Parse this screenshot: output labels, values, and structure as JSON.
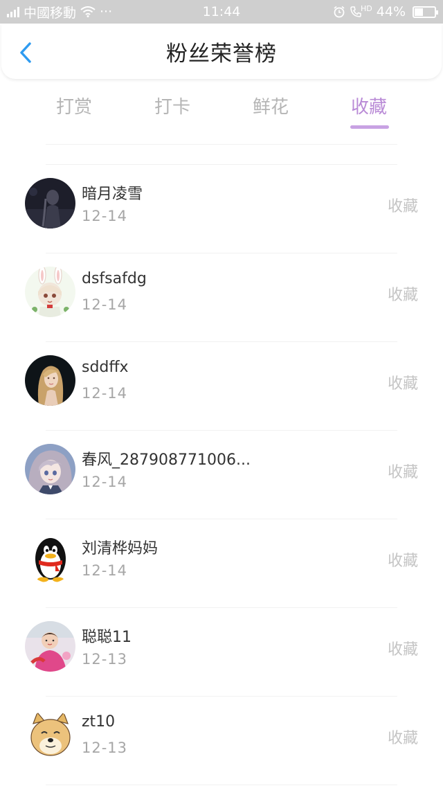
{
  "status_bar": {
    "carrier": "中國移動",
    "dots": "···",
    "time": "11:44",
    "hd": "HD",
    "battery": "44%"
  },
  "header": {
    "title": "粉丝荣誉榜",
    "back_icon": "chevron-left-icon",
    "accent": "#2f9bf0"
  },
  "tabs": [
    {
      "label": "打赏",
      "active": false
    },
    {
      "label": "打卡",
      "active": false
    },
    {
      "label": "鲜花",
      "active": false
    },
    {
      "label": "收藏",
      "active": true
    }
  ],
  "accent_color": "#b98ad6",
  "items": [
    {
      "name": "暗月凌雪",
      "date": "12-14",
      "action": "收藏",
      "avatar": "dark-figure-avatar"
    },
    {
      "name": "dsfsafdg",
      "date": "12-14",
      "action": "收藏",
      "avatar": "bunny-girl-avatar"
    },
    {
      "name": "sddffx",
      "date": "12-14",
      "action": "收藏",
      "avatar": "blonde-girl-avatar"
    },
    {
      "name": "春风_287908771006...",
      "date": "12-14",
      "action": "收藏",
      "avatar": "anime-girl-avatar"
    },
    {
      "name": "刘清桦妈妈",
      "date": "12-14",
      "action": "收藏",
      "avatar": "penguin-avatar"
    },
    {
      "name": "聪聪11",
      "date": "12-13",
      "action": "收藏",
      "avatar": "child-photo-avatar"
    },
    {
      "name": "zt10",
      "date": "12-13",
      "action": "收藏",
      "avatar": "doge-avatar"
    }
  ]
}
